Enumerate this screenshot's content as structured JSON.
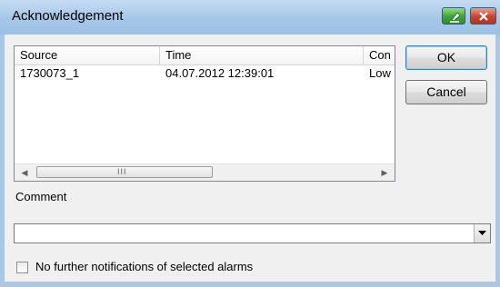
{
  "window": {
    "title": "Acknowledgement",
    "pin_icon": "pin-icon",
    "close_icon": "close-icon"
  },
  "alarm_list": {
    "columns": [
      "Source",
      "Time",
      "Con"
    ],
    "rows": [
      [
        "1730073_1",
        "04.07.2012 12:39:01",
        "Low"
      ]
    ],
    "scroll_left_icon": "◀",
    "scroll_right_icon": "▶",
    "thumb_grip": "III"
  },
  "buttons": {
    "ok": "OK",
    "cancel": "Cancel"
  },
  "comment": {
    "label": "Comment",
    "value": ""
  },
  "no_further_notifications": {
    "label": "No further notifications of selected alarms",
    "checked": false
  }
}
